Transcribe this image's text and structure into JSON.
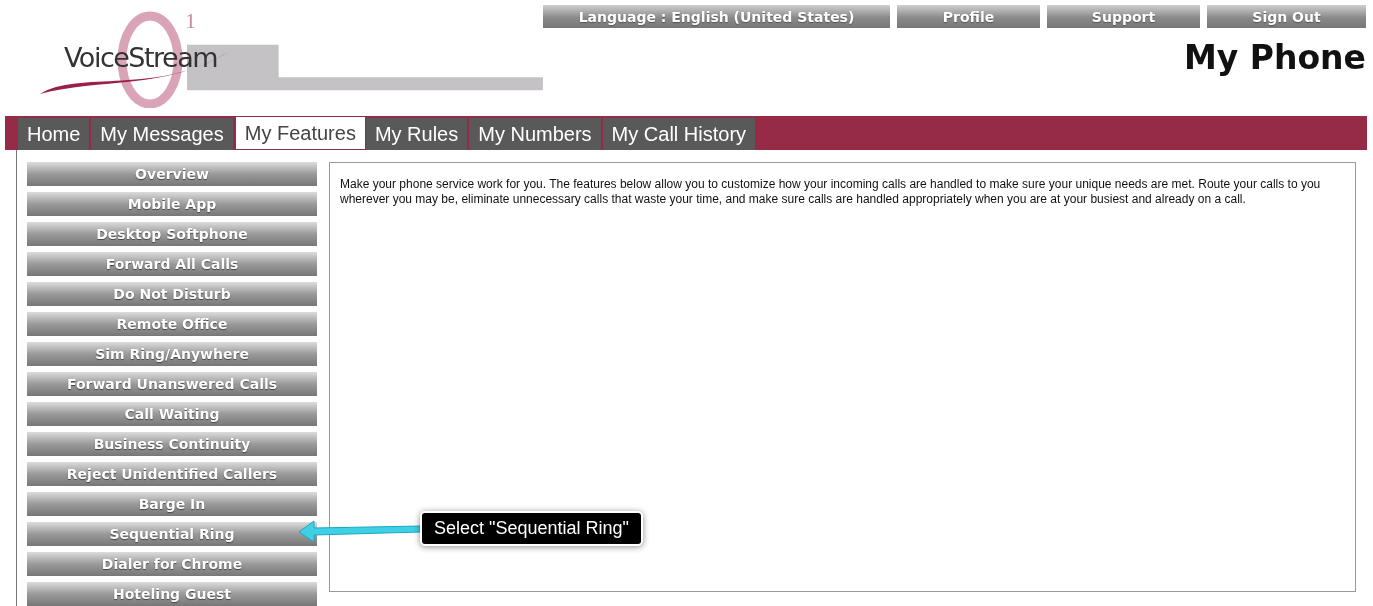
{
  "logo": {
    "text": "VoiceStream",
    "mark": "1"
  },
  "top_links": [
    "Language : English (United States)",
    "Profile",
    "Support",
    "Sign Out"
  ],
  "page_title": "My Phone",
  "tabs": [
    {
      "label": "Home",
      "selected": false
    },
    {
      "label": "My Messages",
      "selected": false
    },
    {
      "label": "My Features",
      "selected": true
    },
    {
      "label": "My Rules",
      "selected": false
    },
    {
      "label": "My Numbers",
      "selected": false
    },
    {
      "label": "My Call History",
      "selected": false
    }
  ],
  "sidebar": {
    "items": [
      "Overview",
      "Mobile App",
      "Desktop Softphone",
      "Forward All Calls",
      "Do Not Disturb",
      "Remote Office",
      "Sim Ring/Anywhere",
      "Forward Unanswered Calls",
      "Call Waiting",
      "Business Continuity",
      "Reject Unidentified Callers",
      "Barge In",
      "Sequential Ring",
      "Dialer for Chrome",
      "Hoteling Guest"
    ]
  },
  "content": {
    "text": "Make your phone service work for you. The features below allow you to customize how your incoming calls are handled to make sure your unique needs are met. Route your calls to you wherever you may be, eliminate unnecessary calls that waste your time, and make sure calls are handled appropriately when you are at your busiest and already on a call."
  },
  "callout": {
    "text": "Select \"Sequential Ring\""
  }
}
